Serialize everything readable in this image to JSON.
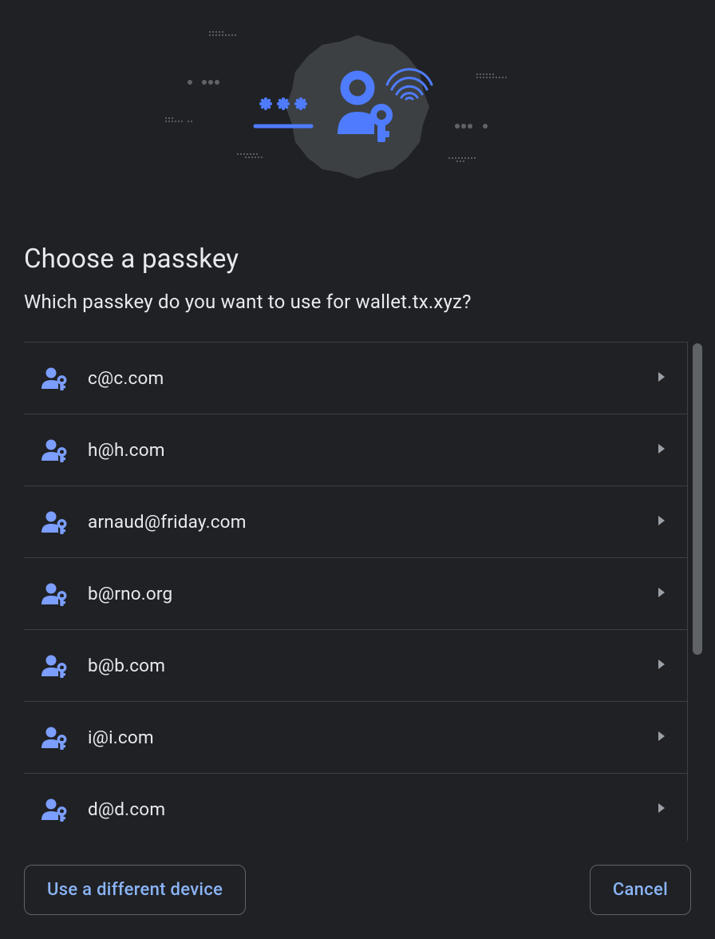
{
  "heading": "Choose a passkey",
  "subheading": "Which passkey do you want to use for wallet.tx.xyz?",
  "passkeys": [
    {
      "label": "c@c.com"
    },
    {
      "label": "h@h.com"
    },
    {
      "label": "arnaud@friday.com"
    },
    {
      "label": "b@rno.org"
    },
    {
      "label": "b@b.com"
    },
    {
      "label": "i@i.com"
    },
    {
      "label": "d@d.com"
    }
  ],
  "buttons": {
    "alt_device": "Use a different device",
    "cancel": "Cancel"
  },
  "colors": {
    "background": "#202124",
    "accent": "#8ab4f8",
    "icon": "#7b9eff",
    "text": "#e8eaed",
    "divider": "#3c4043"
  }
}
